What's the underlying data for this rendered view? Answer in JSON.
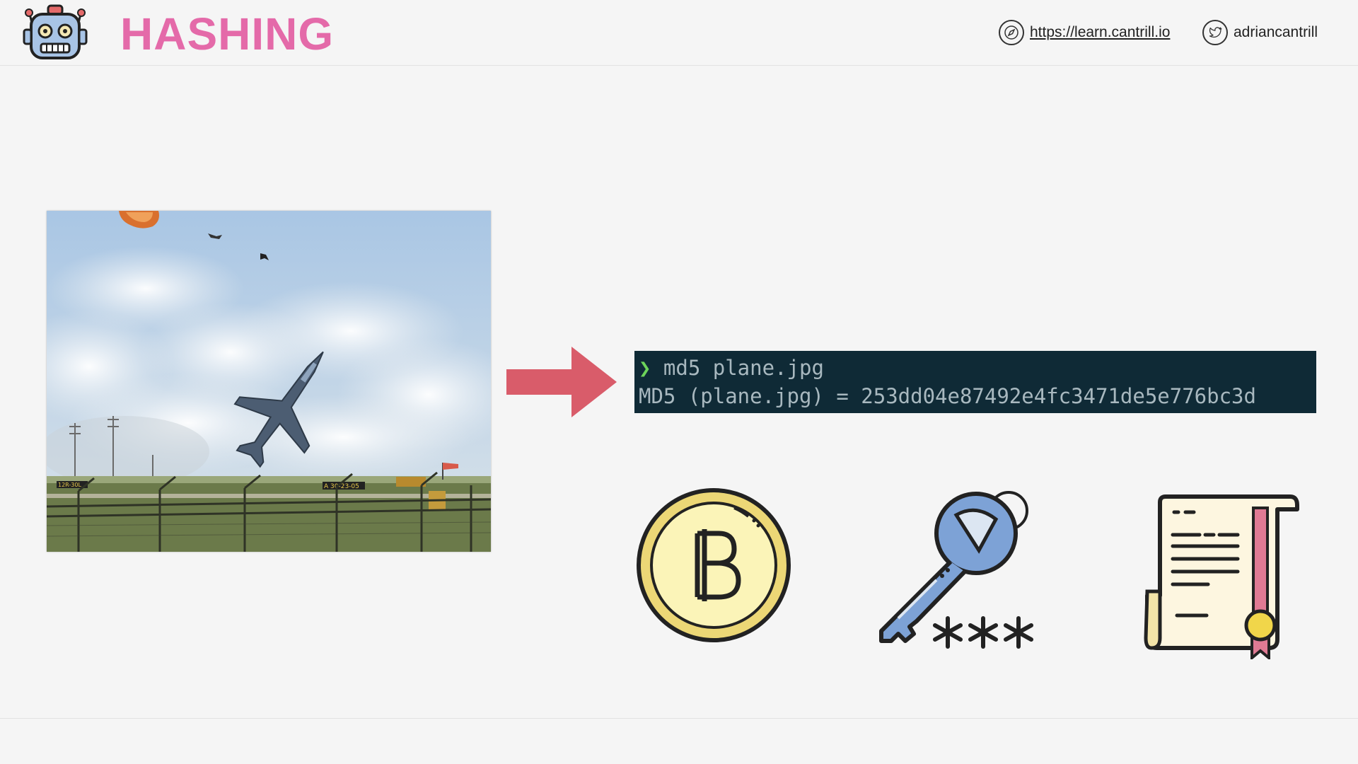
{
  "slide": {
    "title": "HASHING"
  },
  "header": {
    "site_url": "https://learn.cantrill.io",
    "twitter_handle": "adriancantrill",
    "site_icon": "compass-icon",
    "twitter_icon": "twitter-bird-icon",
    "logo_icon": "robot-logo-icon"
  },
  "terminal": {
    "prompt_symbol": "❯",
    "command": " md5 plane.jpg",
    "output": "MD5 (plane.jpg) = 253dd04e87492e4fc3471de5e776bc3d"
  },
  "icons": {
    "coin": "bitcoin-coin-icon",
    "key": "key-password-icon",
    "certificate": "certificate-scroll-icon",
    "arrow": "right-arrow-icon"
  },
  "photo": {
    "runway_sign_left": "12R-30L",
    "runway_sign_center": "A 30-23-05"
  },
  "colors": {
    "title": "#e46aa9",
    "arrow": "#d95c6a",
    "terminal_bg": "#0f2a36",
    "terminal_text": "#a8b8bf",
    "prompt": "#6dd35a"
  }
}
